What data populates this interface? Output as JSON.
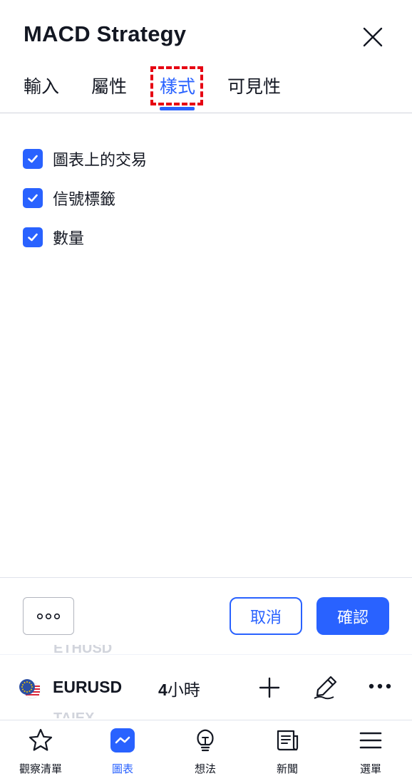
{
  "dialog": {
    "title": "MACD Strategy",
    "close_icon": "close-icon"
  },
  "tabs": [
    {
      "label": "輸入",
      "active": false
    },
    {
      "label": "屬性",
      "active": false
    },
    {
      "label": "樣式",
      "active": true
    },
    {
      "label": "可見性",
      "active": false
    }
  ],
  "options": [
    {
      "label": "圖表上的交易",
      "checked": true
    },
    {
      "label": "信號標籤",
      "checked": true
    },
    {
      "label": "數量",
      "checked": true
    }
  ],
  "footer": {
    "more_icon": "more-horizontal-icon",
    "cancel_label": "取消",
    "confirm_label": "確認"
  },
  "symbol_bar": {
    "ghost_above": "ETHUSD",
    "ghost_below": "TAIEX",
    "symbol": "EURUSD",
    "interval_number": "4",
    "interval_unit": "小時",
    "flag_icon": "eu-us-flag-icon"
  },
  "bottom_nav": [
    {
      "label": "觀察清單",
      "icon": "star-icon",
      "active": false
    },
    {
      "label": "圖表",
      "icon": "chart-icon",
      "active": true
    },
    {
      "label": "想法",
      "icon": "lightbulb-icon",
      "active": false
    },
    {
      "label": "新聞",
      "icon": "newspaper-icon",
      "active": false
    },
    {
      "label": "選單",
      "icon": "menu-icon",
      "active": false
    }
  ],
  "colors": {
    "accent": "#2962ff",
    "text": "#131722",
    "highlight": "#e60012"
  }
}
